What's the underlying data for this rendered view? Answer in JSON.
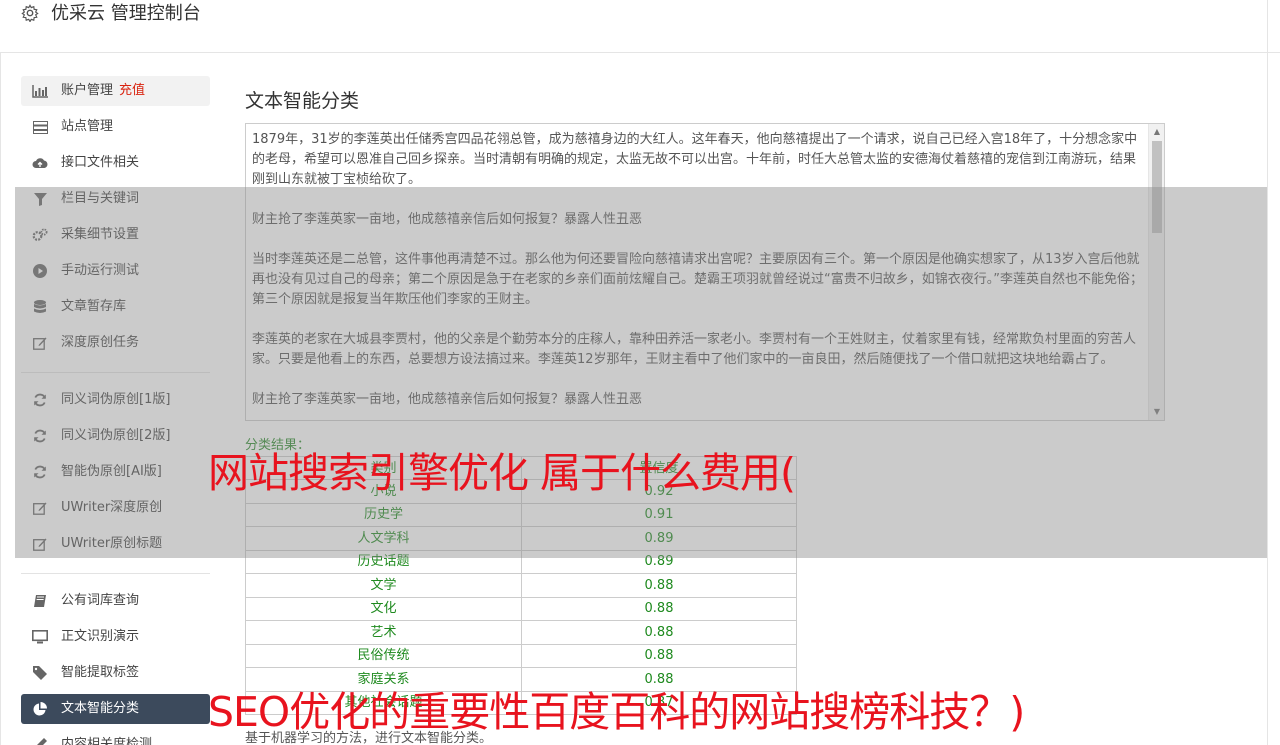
{
  "header": {
    "title": "优采云 管理控制台",
    "icon": "gear-icon"
  },
  "sidebar": {
    "group1": [
      {
        "label": "账户管理",
        "badge": "充值",
        "icon": "bar-chart-icon"
      },
      {
        "label": "站点管理",
        "icon": "server-icon"
      },
      {
        "label": "接口文件相关",
        "icon": "cloud-upload-icon"
      },
      {
        "label": "栏目与关键词",
        "icon": "filter-icon"
      },
      {
        "label": "采集细节设置",
        "icon": "cogs-icon"
      },
      {
        "label": "手动运行测试",
        "icon": "play-circle-icon"
      },
      {
        "label": "文章暂存库",
        "icon": "database-icon"
      },
      {
        "label": "深度原创任务",
        "icon": "edit-icon"
      }
    ],
    "group2": [
      {
        "label": "同义词伪原创[1版]",
        "icon": "refresh-icon"
      },
      {
        "label": "同义词伪原创[2版]",
        "icon": "refresh-icon"
      },
      {
        "label": "智能伪原创[AI版]",
        "icon": "refresh-icon"
      },
      {
        "label": "UWriter深度原创",
        "icon": "edit-icon"
      },
      {
        "label": "UWriter原创标题",
        "icon": "edit-icon"
      }
    ],
    "group3": [
      {
        "label": "公有词库查询",
        "icon": "book-icon"
      },
      {
        "label": "正文识别演示",
        "icon": "monitor-icon"
      },
      {
        "label": "智能提取标签",
        "icon": "tag-icon"
      },
      {
        "label": "文本智能分类",
        "icon": "pie-chart-icon"
      },
      {
        "label": "内容相关度检测",
        "icon": "pen-icon"
      }
    ]
  },
  "main": {
    "title": "文本智能分类",
    "textarea_paragraphs": [
      "1879年，31岁的李莲英出任储秀宫四品花翎总管，成为慈禧身边的大红人。这年春天，他向慈禧提出了一个请求，说自己已经入宫18年了，十分想念家中的老母，希望可以恩准自己回乡探亲。当时清朝有明确的规定，太监无故不可以出宫。十年前，时任大总管太监的安德海仗着慈禧的宠信到江南游玩，结果刚到山东就被丁宝桢给砍了。",
      "财主抢了李莲英家一亩地，他成慈禧亲信后如何报复？暴露人性丑恶",
      "当时李莲英还是二总管，这件事他再清楚不过。那么他为何还要冒险向慈禧请求出宫呢？主要原因有三个。第一个原因是他确实想家了，从13岁入宫后他就再也没有见过自己的母亲；第二个原因是急于在老家的乡亲们面前炫耀自己。楚霸王项羽就曾经说过“富贵不归故乡，如锦衣夜行。”李莲英自然也不能免俗；第三个原因就是报复当年欺压他们李家的王财主。",
      "李莲英的老家在大城县李贾村，他的父亲是个勤劳本分的庄稼人，靠种田养活一家老小。李贾村有一个王姓财主，仗着家里有钱，经常欺负村里面的穷苦人家。只要是他看上的东西，总要想方设法搞过来。李莲英12岁那年，王财主看中了他们家中的一亩良田，然后随便找了一个借口就把这块地给霸占了。",
      "财主抢了李莲英家一亩地，他成慈禧亲信后如何报复？暴露人性丑恶"
    ],
    "result_label": "分类结果：",
    "table_header": [
      "类别",
      "置信度"
    ],
    "table_rows": [
      [
        "小说",
        "0.92"
      ],
      [
        "历史学",
        "0.91"
      ],
      [
        "人文学科",
        "0.89"
      ],
      [
        "历史话题",
        "0.89"
      ],
      [
        "文学",
        "0.88"
      ],
      [
        "文化",
        "0.88"
      ],
      [
        "艺术",
        "0.88"
      ],
      [
        "民俗传统",
        "0.88"
      ],
      [
        "家庭关系",
        "0.88"
      ],
      [
        "其他社会话题",
        "0.87"
      ]
    ],
    "bottom_note": "基于机器学习的方法，进行文本智能分类。"
  },
  "overlay": {
    "headline1": "网站搜索引擎优化 属于什么费用(",
    "headline2": "SEO优化的重要性百度百科的网站搜榜科技？)"
  },
  "colors": {
    "active_nav": "#3c4a5c",
    "recharge": "#d9230f",
    "result_green": "#1f8a1f",
    "spam_red": "#e8131e"
  }
}
